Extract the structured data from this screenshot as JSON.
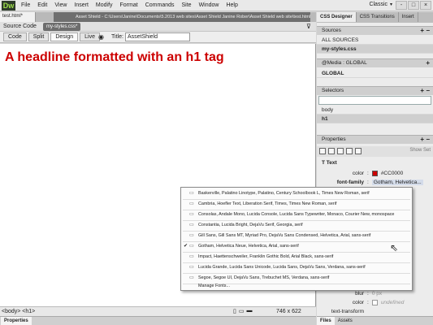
{
  "app": {
    "logo": "Dw",
    "menus": [
      "File",
      "Edit",
      "View",
      "Insert",
      "Modify",
      "Format",
      "Commands",
      "Site",
      "Window",
      "Help"
    ],
    "workspace": "Classic",
    "window_buttons": [
      "-",
      "□",
      "×"
    ]
  },
  "document": {
    "tab_name": "test.html*",
    "path": "Asset Shield - C:\\Users\\Janine\\Documents\\5.2013 web sites\\Asset Shield Janine Rober\\Asset Shield web site\\test.html",
    "source_code_label": "Source Code",
    "related_file": "my-styles.css*",
    "view_buttons": [
      "Code",
      "Split",
      "Design",
      "Live"
    ],
    "active_view": "Design",
    "title_label": "Title:",
    "title_value": "AssetShield",
    "headline": "A headline formatted with an h1 tag"
  },
  "status": {
    "tag_selector": "<body> <h1>",
    "dimensions": "746 x 622",
    "properties_tab": "Properties"
  },
  "panel": {
    "tabs": [
      "CSS Designer",
      "CSS Transitions",
      "Insert"
    ],
    "sources_header": "Sources",
    "sources": [
      "ALL SOURCES",
      "my-styles.css"
    ],
    "media_header": "@Media : GLOBAL",
    "media": [
      "GLOBAL"
    ],
    "selectors_header": "Selectors",
    "selectors": [
      "body",
      "h1"
    ],
    "properties_header": "Properties",
    "show_set": "Show Set",
    "text_section": "Text",
    "color_label": "color",
    "color_value": "#CC0000",
    "color_swatch": "#cc0000",
    "font_family_label": "font-family",
    "font_family_value": "Gotham, Helvetica...",
    "blur_label": "blur",
    "blur_value": "0 px",
    "color2_label": "color",
    "color2_value": "undefined",
    "text_transform_label": "text-transform",
    "bottom_tabs": [
      "Files",
      "Assets"
    ]
  },
  "font_menu": {
    "items": [
      "Baskerville, Palatino Linotype, Palatino, Century Schoolbook L, Times New Roman, serif",
      "Cambria, Hoefler Text, Liberation Serif, Times, Times New Roman, serif",
      "Consolas, Andale Mono, Lucida Console, Lucida Sans Typewriter, Monaco, Courier New, monospace",
      "Constantia, Lucida Bright, DejaVu Serif, Georgia, serif",
      "Gill Sans, Gill Sans MT, Myriad Pro, DejaVu Sans Condensed, Helvetica, Arial, sans-serif",
      "Gotham, Helvetica Neue, Helvetica, Arial, sans-serif",
      "Impact, Haettenschweiler, Franklin Gothic Bold, Arial Black, sans-serif",
      "Lucida Grande, Lucida Sans Unicode, Lucida Sans, DejaVu Sans, Verdana, sans-serif",
      "Segoe, Segoe UI, DejaVu Sans, Trebuchet MS, Verdana, sans-serif"
    ],
    "checked_index": 5,
    "manage": "Manage Fonts..."
  }
}
